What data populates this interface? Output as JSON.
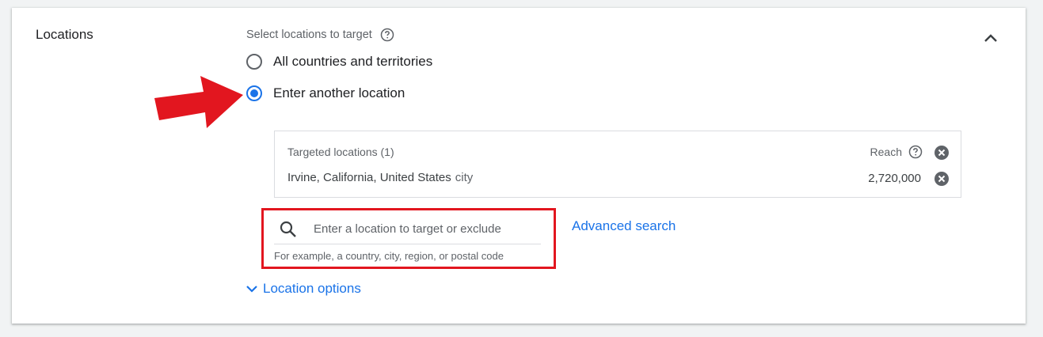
{
  "section": {
    "title": "Locations"
  },
  "targeting": {
    "select_label": "Select locations to target",
    "options": [
      {
        "label": "All countries and territories",
        "selected": false
      },
      {
        "label": "Enter another location",
        "selected": true
      }
    ]
  },
  "targeted_locations": {
    "header": "Targeted locations (1)",
    "reach_label": "Reach",
    "rows": [
      {
        "name": "Irvine, California, United States",
        "type": "city",
        "reach": "2,720,000"
      }
    ]
  },
  "search": {
    "placeholder": "Enter a location to target or exclude",
    "hint": "For example, a country, city, region, or postal code"
  },
  "advanced_search_label": "Advanced search",
  "location_options_label": "Location options",
  "colors": {
    "accent": "#1a73e8",
    "annotation_red": "#e2161f"
  },
  "icons": [
    "chevron-up-icon",
    "help-icon",
    "close-circle-icon",
    "search-icon",
    "chevron-down-icon",
    "red-arrow-icon"
  ]
}
